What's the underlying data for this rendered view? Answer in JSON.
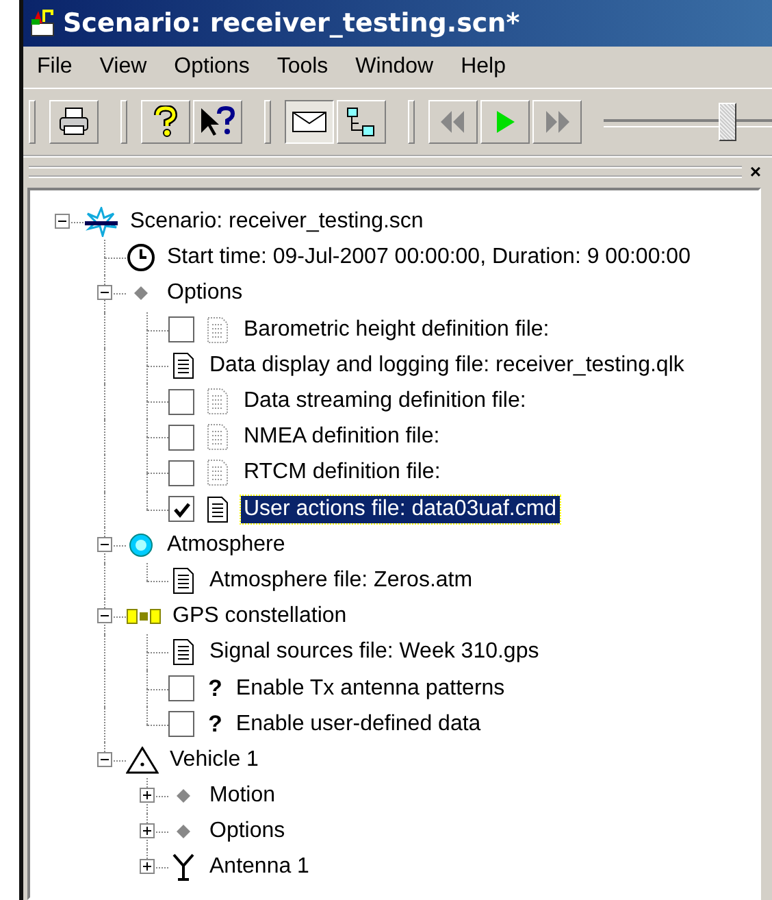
{
  "window": {
    "title": "Scenario: receiver_testing.scn*"
  },
  "menu": [
    "File",
    "View",
    "Options",
    "Tools",
    "Window",
    "Help"
  ],
  "toolbar": [
    {
      "kind": "printer",
      "pressed": false
    },
    {
      "kind": "help",
      "pressed": false
    },
    {
      "kind": "context-help",
      "pressed": false
    },
    {
      "kind": "envelope",
      "pressed": true
    },
    {
      "kind": "hierarchy",
      "pressed": false
    },
    {
      "kind": "rewind",
      "disabled": true
    },
    {
      "kind": "play",
      "disabled": false
    },
    {
      "kind": "fast-forward",
      "disabled": true
    }
  ],
  "slider": {
    "level": 0.72
  },
  "panel": {
    "close": "×"
  },
  "tree": [
    {
      "label": "Scenario: receiver_testing.scn",
      "kind": "star",
      "expanded": true,
      "selected": false,
      "children": [
        {
          "label": "Start time: 09-Jul-2007 00:00:00, Duration: 9 00:00:00",
          "kind": "clock",
          "selected": false
        },
        {
          "label": "Options",
          "kind": "diamond",
          "expanded": true,
          "selected": false,
          "children": [
            {
              "label": "Barometric height definition file:",
              "kind": "file-dim",
              "checked": false,
              "selected": false
            },
            {
              "label": "Data display and logging file: receiver_testing.qlk",
              "kind": "file",
              "selected": false
            },
            {
              "label": "Data streaming definition file:",
              "kind": "file-dim",
              "checked": false,
              "selected": false
            },
            {
              "label": "NMEA definition file:",
              "kind": "file-dim",
              "checked": false,
              "selected": false
            },
            {
              "label": "RTCM definition file:",
              "kind": "file-dim",
              "checked": false,
              "selected": false
            },
            {
              "label": "User actions file: data03uaf.cmd",
              "kind": "file",
              "checked": true,
              "selected": true
            }
          ]
        },
        {
          "label": "Atmosphere",
          "kind": "sphere",
          "expanded": true,
          "selected": false,
          "children": [
            {
              "label": "Atmosphere file: Zeros.atm",
              "kind": "file",
              "selected": false
            }
          ]
        },
        {
          "label": "GPS constellation",
          "kind": "satellite",
          "expanded": true,
          "selected": false,
          "children": [
            {
              "label": "Signal sources file: Week 310.gps",
              "kind": "file",
              "selected": false
            },
            {
              "label": "Enable Tx antenna patterns",
              "kind": "question",
              "glyph": "?",
              "checked": false,
              "selected": false
            },
            {
              "label": "Enable user-defined data",
              "kind": "question",
              "glyph": "?",
              "checked": false,
              "selected": false
            }
          ]
        },
        {
          "label": "Vehicle 1",
          "kind": "triangle",
          "expanded": true,
          "selected": false,
          "children": [
            {
              "label": "Motion",
              "kind": "diamond",
              "expanded": false,
              "selected": false
            },
            {
              "label": "Options",
              "kind": "diamond",
              "expanded": false,
              "selected": false
            },
            {
              "label": "Antenna 1",
              "kind": "antenna",
              "expanded": false,
              "selected": false
            }
          ]
        }
      ]
    }
  ]
}
